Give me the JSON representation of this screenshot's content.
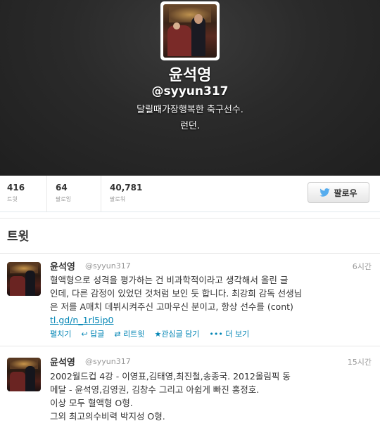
{
  "profile": {
    "name": "윤석영",
    "handle": "@syyun317",
    "bio": "달릴때가장행복한 축구선수.",
    "location": "런던."
  },
  "stats": [
    {
      "num": "416",
      "label": "트윗"
    },
    {
      "num": "64",
      "label": "팔로잉"
    },
    {
      "num": "40,781",
      "label": "팔로워"
    }
  ],
  "follow_label": "팔로우",
  "section_title": "트윗",
  "tweets": [
    {
      "name": "윤석영",
      "handle": "@syyun317",
      "time": "6시간",
      "lines": [
        "혈액형으로 성격을 평가하는 건 비과학적이라고 생각해서 올린 글",
        "인데, 다른 감정이 있었던 것처럼 보인 듯 합니다. 최강희 감독 선생님",
        "은 저를 A매치 데뷔시켜주신 고마우신 분이고, 항상 선수를 (cont)"
      ],
      "link": "tl.gd/n_1rl5ip0",
      "actions": {
        "expand": "펼치기",
        "reply": "답글",
        "retweet": "리트윗",
        "favorite": "관심글 담기",
        "more": "더 보기"
      }
    },
    {
      "name": "윤석영",
      "handle": "@syyun317",
      "time": "15시간",
      "lines": [
        "2002월드컵 4강 - 이영표,김태영,최진철,송종국. 2012올림픽 동",
        "메달 - 윤석영,김영권, 김창수 그리고 아쉽게 빠진 홍정호.",
        "이상 모두 혈액형 O형.",
        "그외 최고의수비력 박지성 O형."
      ]
    }
  ],
  "colors": {
    "link": "#0084b4",
    "header_bg": "#2a2a2a",
    "bird": "#55acee"
  }
}
